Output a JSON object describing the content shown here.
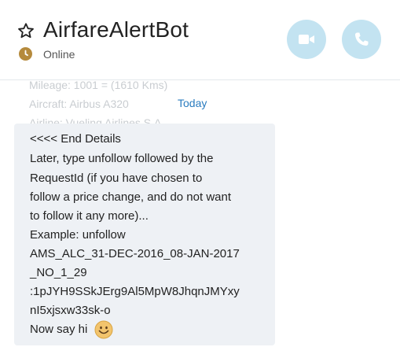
{
  "header": {
    "bot_name": "AirfareAlertBot",
    "status": "Online",
    "status_color": "#b58a3c",
    "favorite_icon": "star-outline-icon",
    "video_call_icon": "video-camera-icon",
    "audio_call_icon": "phone-icon",
    "button_color": "#c3e3f1"
  },
  "conversation": {
    "faded_previous_lines": [
      "Mileage: 1001 = (1610 Kms)",
      "Aircraft: Airbus A320",
      "Airline: Vueling Airlines S.A."
    ],
    "date_divider": "Today",
    "message": {
      "lines": [
        "<<<< End Details",
        "Later, type unfollow followed by the",
        "RequestId (if you have chosen to",
        "follow a price change,  and do not want",
        "to follow it any more)...",
        "Example: unfollow",
        "AMS_ALC_31-DEC-2016_08-JAN-2017",
        "_NO_1_29",
        ":1pJYH9SSkJErg9Al5MpW8JhqnJMYxy",
        "nI5xjsxw33sk-o"
      ],
      "final_line": "Now say hi",
      "emoji": "smile-emoji"
    }
  }
}
